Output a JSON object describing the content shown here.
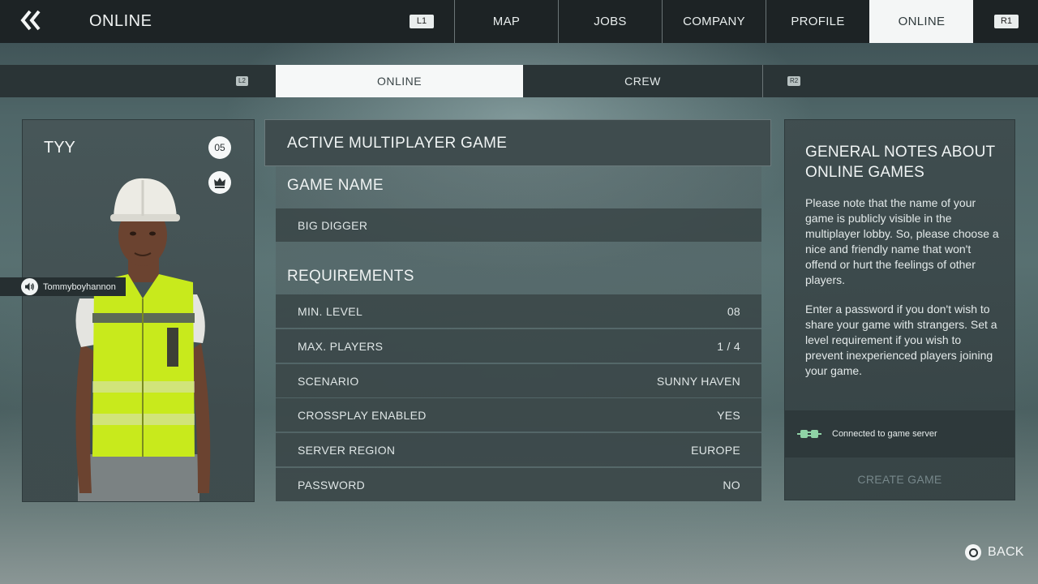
{
  "header": {
    "title": "ONLINE",
    "left_shoulder": "L1",
    "right_shoulder": "R1",
    "tabs": [
      {
        "label": "MAP"
      },
      {
        "label": "JOBS"
      },
      {
        "label": "COMPANY"
      },
      {
        "label": "PROFILE"
      },
      {
        "label": "ONLINE",
        "active": true
      }
    ]
  },
  "subnav": {
    "left_trigger": "L2",
    "right_trigger": "R2",
    "tabs": [
      {
        "label": "ONLINE",
        "active": true
      },
      {
        "label": "CREW"
      }
    ]
  },
  "player": {
    "name": "TYY",
    "level": "05",
    "voice_username": "Tommyboyhannon",
    "icons": [
      "crown-icon",
      "speaker-icon"
    ]
  },
  "game": {
    "title": "ACTIVE MULTIPLAYER GAME",
    "name_heading": "GAME NAME",
    "name_value": "BIG DIGGER",
    "requirements_heading": "REQUIREMENTS",
    "rows": [
      {
        "label": "MIN. LEVEL",
        "value": "08"
      },
      {
        "label": "MAX. PLAYERS",
        "value": "1 / 4"
      },
      {
        "label": "SCENARIO",
        "value": "SUNNY HAVEN"
      },
      {
        "label": "CROSSPLAY ENABLED",
        "value": "YES"
      },
      {
        "label": "SERVER REGION",
        "value": "EUROPE"
      },
      {
        "label": "PASSWORD",
        "value": "NO"
      }
    ]
  },
  "notes": {
    "title": "GENERAL NOTES ABOUT ONLINE GAMES",
    "paragraph1": "Please note that the name of your game is publicly visible in the multiplayer lobby. So, please choose a nice and friendly name that won't offend or hurt the feelings of other players.",
    "paragraph2": "Enter a password if you don't wish to share your game with strangers. Set a level requirement if you wish to prevent inexperienced players joining your game.",
    "server_status": "Connected to game server",
    "create_button": "CREATE GAME"
  },
  "footer": {
    "back_label": "BACK"
  },
  "colors": {
    "accent_active": "#f4f6f6",
    "server_connected": "#8fd3a6",
    "vest": "#c8ea1c"
  }
}
